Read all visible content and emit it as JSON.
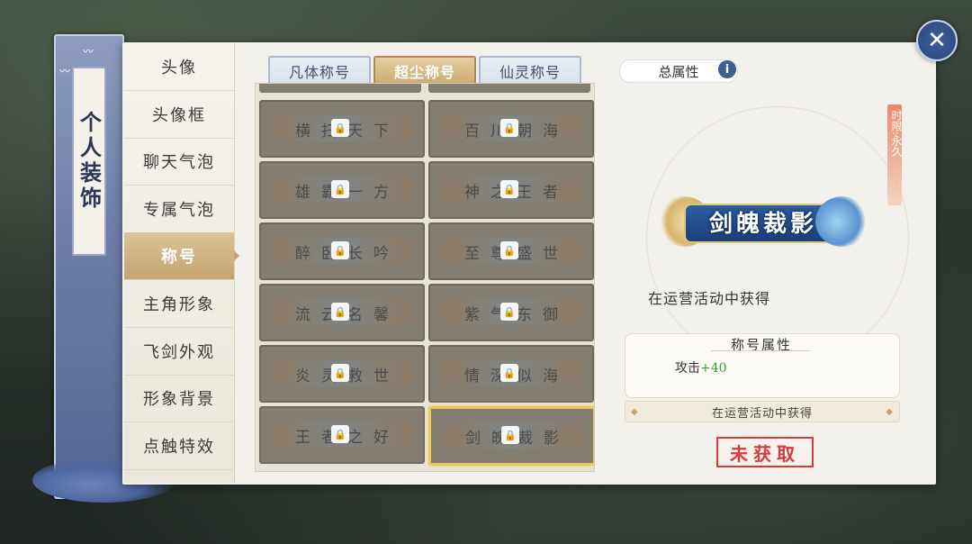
{
  "banner": {
    "title": "个人装饰"
  },
  "menu": [
    {
      "label": "头像"
    },
    {
      "label": "头像框"
    },
    {
      "label": "聊天气泡"
    },
    {
      "label": "专属气泡"
    },
    {
      "label": "称号",
      "active": true
    },
    {
      "label": "主角形象"
    },
    {
      "label": "飞剑外观"
    },
    {
      "label": "形象背景"
    },
    {
      "label": "点触特效"
    }
  ],
  "tabs": [
    {
      "label": "凡体称号"
    },
    {
      "label": "超尘称号",
      "active": true
    },
    {
      "label": "仙灵称号"
    }
  ],
  "titles": [
    {
      "name": "横扫天下",
      "locked": true
    },
    {
      "name": "百川朝海",
      "locked": true
    },
    {
      "name": "雄霸一方",
      "locked": true
    },
    {
      "name": "神之王者",
      "locked": true
    },
    {
      "name": "醉卧长吟",
      "locked": true
    },
    {
      "name": "至尊盛世",
      "locked": true
    },
    {
      "name": "流云名馨",
      "locked": true
    },
    {
      "name": "紫气东御",
      "locked": true
    },
    {
      "name": "炎灵救世",
      "locked": true
    },
    {
      "name": "情深似海",
      "locked": true
    },
    {
      "name": "王者之好",
      "locked": true
    },
    {
      "name": "剑魄裁影",
      "locked": true,
      "selected": true
    }
  ],
  "detail": {
    "total_attr_label": "总属性",
    "info_icon": "i",
    "time_tag": "时限:永久",
    "title_name": "剑魄裁影",
    "source_text": "在运营活动中获得",
    "attr_header": "称号属性",
    "attr_name": "攻击",
    "attr_value": "+40",
    "source_bar": "在运营活动中获得",
    "status_stamp": "未获取"
  },
  "close_icon": "✕",
  "colors": {
    "accent_gold": "#c4a370",
    "stamp_red": "#d43b3b",
    "attr_green": "#3a9a3a",
    "banner_blue": "#6f7fa8"
  }
}
